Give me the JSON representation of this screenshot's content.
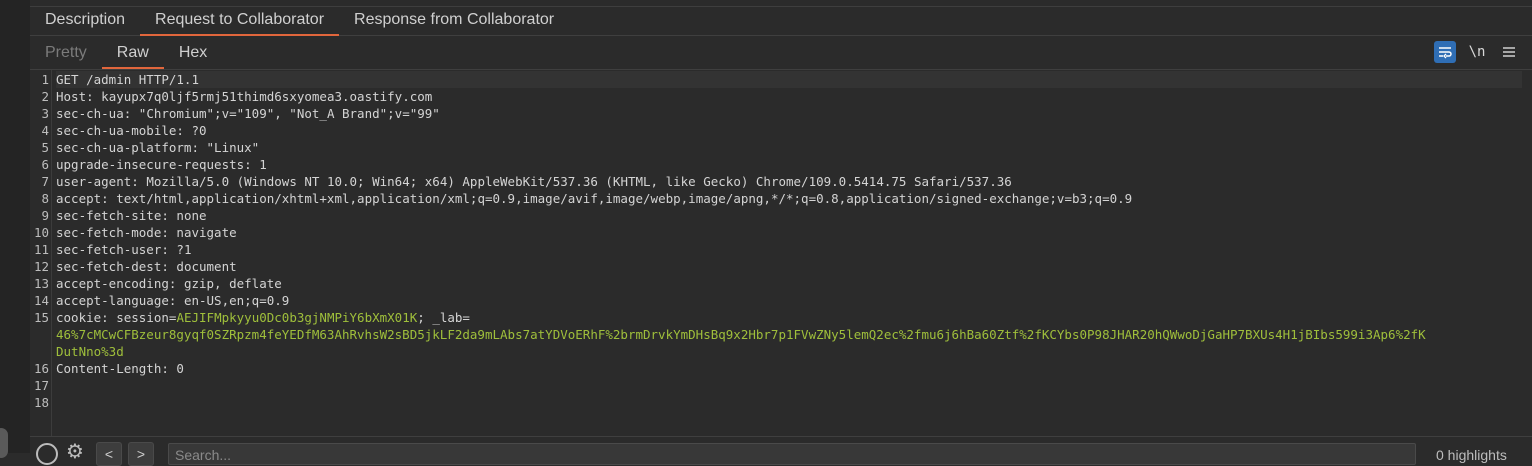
{
  "tabs": [
    {
      "label": "Description",
      "active": false
    },
    {
      "label": "Request to Collaborator",
      "active": true
    },
    {
      "label": "Response from Collaborator",
      "active": false
    }
  ],
  "subtabs": [
    {
      "label": "Pretty",
      "active": false
    },
    {
      "label": "Raw",
      "active": true
    },
    {
      "label": "Hex",
      "active": false
    }
  ],
  "toolbar": {
    "wrap_icon": "text-wrap-icon",
    "newline_label": "\\n",
    "menu_icon": "hamburger-menu-icon"
  },
  "request": {
    "lines": [
      {
        "n": "1",
        "name": "GET /admin HTTP/1.1",
        "sep": "",
        "value": ""
      },
      {
        "n": "2",
        "name": "Host",
        "sep": ": ",
        "value": "kayupx7q0ljf5rmj51thimd6sxyomea3.oastify.com"
      },
      {
        "n": "3",
        "name": "sec-ch-ua",
        "sep": ": ",
        "value": "\"Chromium\";v=\"109\", \"Not_A Brand\";v=\"99\""
      },
      {
        "n": "4",
        "name": "sec-ch-ua-mobile",
        "sep": ": ",
        "value": "?0"
      },
      {
        "n": "5",
        "name": "sec-ch-ua-platform",
        "sep": ": ",
        "value": "\"Linux\""
      },
      {
        "n": "6",
        "name": "upgrade-insecure-requests",
        "sep": ": ",
        "value": "1"
      },
      {
        "n": "7",
        "name": "user-agent",
        "sep": ": ",
        "value": "Mozilla/5.0 (Windows NT 10.0; Win64; x64) AppleWebKit/537.36 (KHTML, like Gecko) Chrome/109.0.5414.75 Safari/537.36"
      },
      {
        "n": "8",
        "name": "accept",
        "sep": ": ",
        "value": "text/html,application/xhtml+xml,application/xml;q=0.9,image/avif,image/webp,image/apng,*/*;q=0.8,application/signed-exchange;v=b3;q=0.9"
      },
      {
        "n": "9",
        "name": "sec-fetch-site",
        "sep": ": ",
        "value": "none"
      },
      {
        "n": "10",
        "name": "sec-fetch-mode",
        "sep": ": ",
        "value": "navigate"
      },
      {
        "n": "11",
        "name": "sec-fetch-user",
        "sep": ": ",
        "value": "?1"
      },
      {
        "n": "12",
        "name": "sec-fetch-dest",
        "sep": ": ",
        "value": "document"
      },
      {
        "n": "13",
        "name": "accept-encoding",
        "sep": ": ",
        "value": "gzip, deflate"
      },
      {
        "n": "14",
        "name": "accept-language",
        "sep": ": ",
        "value": "en-US,en;q=0.9"
      }
    ],
    "cookie": {
      "n": "15",
      "name": "cookie",
      "sep": ": ",
      "session_key": "session=",
      "session_value": "AEJIFMpkyyu0Dc0b3gjNMPiY6bXmX01K",
      "divider": "; ",
      "lab_key": "_lab=",
      "lab_value_1": "46%7cMCwCFBzeur8gyqf0SZRpzm4feYEDfM63AhRvhsW2sBD5jkLF2da9mLAbs7atYDVoERhF%2brmDrvkYmDHsBq9x2Hbr7p1FVwZNy5lemQ2ec%2fmu6j6hBa60Ztf%2fKCYbs0P98JHAR20hQWwoDjGaHP7BXUs4H1jBIbs599i3Ap6%2fK",
      "lab_value_2": "DutNno%3d"
    },
    "tail": [
      {
        "n": "16",
        "name": "Content-Length",
        "sep": ": ",
        "value": "0"
      },
      {
        "n": "17",
        "name": "",
        "sep": "",
        "value": ""
      },
      {
        "n": "18",
        "name": "",
        "sep": "",
        "value": ""
      }
    ]
  },
  "bottom": {
    "help_icon": "help-icon",
    "settings_icon": "gear-icon",
    "prev_label": "<",
    "next_label": ">",
    "search_placeholder": "Search...",
    "highlights": "0 highlights"
  },
  "colors": {
    "accent": "#e1663c",
    "value_green": "#9fbf3b",
    "wrap_active": "#2f6eb5"
  }
}
